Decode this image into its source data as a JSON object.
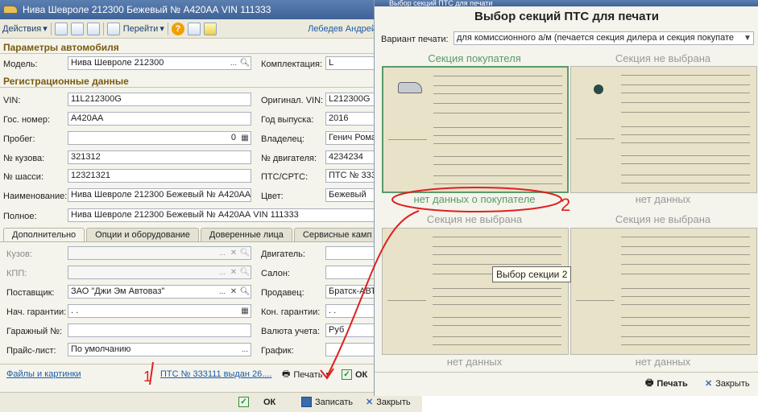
{
  "main_window": {
    "title": "Нива Шевроле 212300 Бежевый № А420АА VIN 111333",
    "toolbar": {
      "actions": "Действия",
      "goto": "Перейти",
      "help": "?",
      "user": "Лебедев Андрей"
    },
    "sections": {
      "car_params": "Параметры автомобиля",
      "registration": "Регистрационные данные"
    },
    "fields": {
      "model_label": "Модель:",
      "model_value": "Нива Шевроле 212300",
      "kit_label": "Комплектация:",
      "kit_value": "L",
      "vin_label": "VIN:",
      "vin_value": "11L212300G",
      "orig_vin_label": "Оригинал. VIN:",
      "orig_vin_value": "L212300G",
      "gos_label": "Гос. номер:",
      "gos_value": "А420АА",
      "year_label": "Год выпуска:",
      "year_value": "2016",
      "mileage_label": "Пробег:",
      "mileage_value": "0",
      "owner_label": "Владелец:",
      "owner_value": "Генич Рома",
      "body_no_label": "№ кузова:",
      "body_no_value": "321312",
      "engine_no_label": "№ двигателя:",
      "engine_no_value": "4234234",
      "chassis_label": "№ шасси:",
      "chassis_value": "12321321",
      "pts_label": "ПТС/СРТС:",
      "pts_value": "ПТС  № 333",
      "name_label": "Наименование:",
      "name_value": "Нива Шевроле 212300 Бежевый № А420АА",
      "color_label": "Цвет:",
      "color_value": "Бежевый",
      "full_label": "Полное:",
      "full_value": "Нива Шевроле 212300 Бежевый № А420АА VIN 111333"
    },
    "tabs": [
      "Дополнительно",
      "Опции и оборудование",
      "Доверенные лица",
      "Сервисные камп"
    ],
    "extra": {
      "body_label": "Кузов:",
      "engine_label": "Двигатель:",
      "kpp_label": "КПП:",
      "salon_label": "Салон:",
      "supplier_label": "Поставщик:",
      "supplier_value": "ЗАО \"Джи Эм Автоваз\"",
      "seller_label": "Продавец:",
      "seller_value": "Братск-АВТ",
      "warranty_start_label": "Нач. гарантии:",
      "warranty_start_value": " .  .",
      "warranty_end_label": "Кон. гарантии:",
      "warranty_end_value": " .  .",
      "garage_label": "Гаражный №:",
      "currency_label": "Валюта учета:",
      "currency_value": "Руб",
      "pricelist_label": "Прайс-лист:",
      "pricelist_value": "По умолчанию",
      "schedule_label": "График:"
    },
    "footer": {
      "files_link": "Файлы и картинки",
      "pts_link": "ПТС  № 333111 выдан 26....",
      "print": "Печать",
      "ok_partial": "ОК"
    },
    "bottom": {
      "ok": "ОК",
      "save": "Записать",
      "close": "Закрыть"
    }
  },
  "dialog": {
    "window_title": "Выбор секций ПТС для печати",
    "heading": "Выбор секций ПТС для печати",
    "variant_label": "Вариант печати:",
    "variant_value": "для комиссионного а/м (печается секция дилера и секция покупате",
    "cells": [
      {
        "title": "Секция покупателя",
        "footer": "нет данных о покупателе"
      },
      {
        "title": "Секция не выбрана",
        "footer": "нет данных"
      },
      {
        "title": "Секция не выбрана",
        "footer": "нет данных"
      },
      {
        "title": "Секция не выбрана",
        "footer": "нет данных"
      }
    ],
    "tooltip": "Выбор секции 2",
    "print": "Печать",
    "close": "Закрыть"
  },
  "annotations": {
    "mark_1": "1",
    "mark_2": "2"
  },
  "colors": {
    "accent_green": "#5a9a6a",
    "link_blue": "#1d5aa8",
    "annotation_red": "#e02020"
  }
}
